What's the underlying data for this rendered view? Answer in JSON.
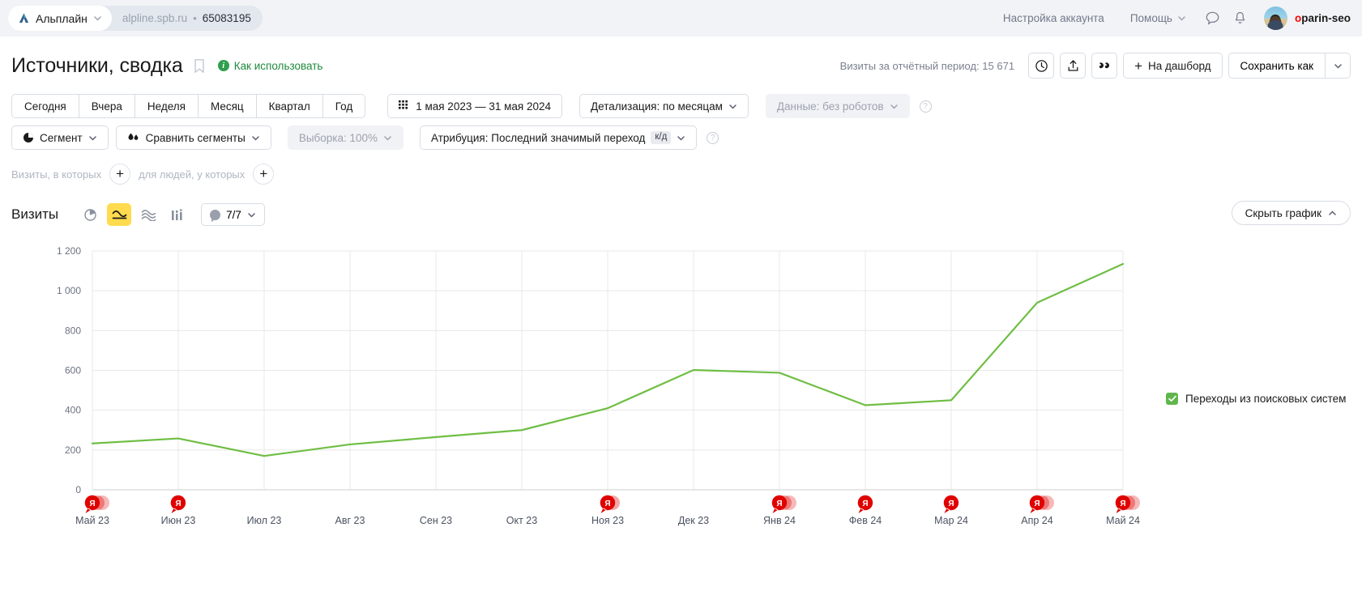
{
  "topbar": {
    "counter_name": "Альплайн",
    "counter_url": "alpline.spb.ru",
    "separator": "•",
    "counter_id": "65083195",
    "account_settings": "Настройка аккаунта",
    "help": "Помощь",
    "username_prefix": "o",
    "username_rest": "parin-seo"
  },
  "head": {
    "title": "Источники, сводка",
    "howto": "Как использовать",
    "visits_summary": "Визиты за отчётный период: 15 671",
    "dashboard_button": "На дашборд",
    "dashboard_plus": "+",
    "save_as": "Сохранить как"
  },
  "periods": {
    "items": [
      "Сегодня",
      "Вчера",
      "Неделя",
      "Месяц",
      "Квартал",
      "Год"
    ],
    "date_range": "1 мая 2023 — 31 мая 2024",
    "detail": "Детализация: по месяцам",
    "data_source": "Данные: без роботов"
  },
  "segments": {
    "segment": "Сегмент",
    "compare": "Сравнить сегменты",
    "sampling": "Выборка: 100%",
    "attribution": "Атрибуция: Последний значимый переход",
    "attribution_badge": "к/д"
  },
  "conditions": {
    "visits_where": "Визиты, в которых",
    "people_where": "для людей, у которых",
    "add": "+"
  },
  "chart_toolbar": {
    "metric_title": "Визиты",
    "types": [
      {
        "name": "pie-chart-icon",
        "active": false
      },
      {
        "name": "line-chart-icon",
        "active": true
      },
      {
        "name": "area-chart-icon",
        "active": false
      },
      {
        "name": "bar-chart-icon",
        "active": false
      }
    ],
    "series_count": "7/7",
    "hide_chart": "Скрыть график"
  },
  "chart_data": {
    "type": "line",
    "title": "Визиты",
    "xlabel": "",
    "ylabel": "",
    "ylim": [
      0,
      1200
    ],
    "yticks": [
      0,
      200,
      400,
      600,
      800,
      1000,
      1200
    ],
    "ytick_labels": [
      "0",
      "200",
      "400",
      "600",
      "800",
      "1 000",
      "1 200"
    ],
    "categories": [
      "Май 23",
      "Июн 23",
      "Июл 23",
      "Авг 23",
      "Сен 23",
      "Окт 23",
      "Ноя 23",
      "Дек 23",
      "Янв 24",
      "Фев 24",
      "Мар 24",
      "Апр 24",
      "Май 24"
    ],
    "grid": true,
    "legend_position": "right",
    "series": [
      {
        "name": "Переходы из поисковых систем",
        "color": "#6fbe44",
        "checked": true,
        "values": [
          233,
          258,
          170,
          228,
          265,
          300,
          410,
          602,
          588,
          425,
          450,
          940,
          1135
        ]
      }
    ],
    "annotations": [
      {
        "category": "Май 23",
        "count": 3,
        "label": "Я"
      },
      {
        "category": "Июн 23",
        "count": 1,
        "label": "Я"
      },
      {
        "category": "Ноя 23",
        "count": 2,
        "label": "Я"
      },
      {
        "category": "Янв 24",
        "count": 3,
        "label": "Я"
      },
      {
        "category": "Фев 24",
        "count": 1,
        "label": "Я"
      },
      {
        "category": "Мар 24",
        "count": 1,
        "label": "Я"
      },
      {
        "category": "Апр 24",
        "count": 3,
        "label": "Я"
      },
      {
        "category": "Май 24",
        "count": 3,
        "label": "Я"
      }
    ]
  },
  "colors": {
    "series_green": "#6fbe44",
    "accent_yellow": "#ffdb4d",
    "annotation_red": "#e00000",
    "link_green": "#1e8a3c"
  }
}
